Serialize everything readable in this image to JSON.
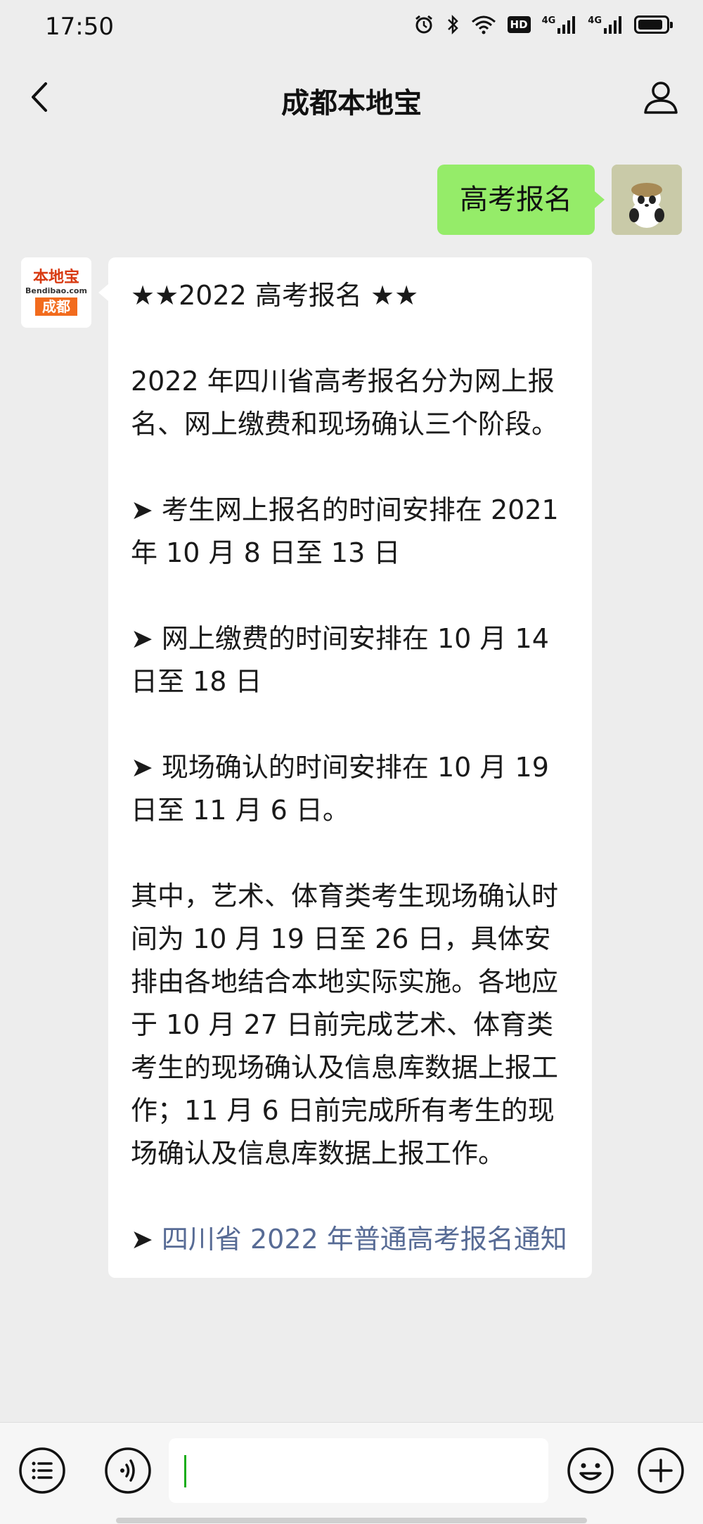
{
  "status_bar": {
    "time": "17:50",
    "hd_label": "HD",
    "network_1": "4G",
    "network_2": "4G",
    "battery_level": 0.9
  },
  "nav": {
    "title": "成都本地宝",
    "back_icon": "chevron-left-icon",
    "profile_icon": "person-icon"
  },
  "chat": {
    "outgoing": {
      "text": "高考报名"
    },
    "incoming": {
      "avatar": {
        "brand": "本地宝",
        "url": "Bendibao.com",
        "city": "成都"
      },
      "heading": "★★2022 高考报名 ★★",
      "intro": "2022 年四川省高考报名分为网上报名、网上缴费和现场确认三个阶段。",
      "item1": "➤ 考生网上报名的时间安排在 2021 年 10 月 8 日至 13 日",
      "item2": "➤ 网上缴费的时间安排在 10 月 14 日至 18 日",
      "item3": "➤ 现场确认的时间安排在 10 月 19 日至 11 月 6 日。",
      "detail": "其中，艺术、体育类考生现场确认时间为 10 月 19 日至 26 日，具体安排由各地结合本地实际实施。各地应于 10 月 27 日前完成艺术、体育类考生的现场确认及信息库数据上报工作；11 月 6 日前完成所有考生的现场确认及信息库数据上报工作。",
      "link_arrow": "➤ ",
      "link_text": "四川省 2022 年普通高考报名通知"
    }
  },
  "bottom_bar": {
    "menu_icon": "list-menu-icon",
    "voice_icon": "voice-icon",
    "emoji_icon": "emoji-icon",
    "plus_icon": "plus-icon",
    "input_value": ""
  },
  "colors": {
    "outgoing_bubble": "#95ec69",
    "link": "#576b95",
    "cursor": "#1aad19",
    "background": "#ededed"
  }
}
